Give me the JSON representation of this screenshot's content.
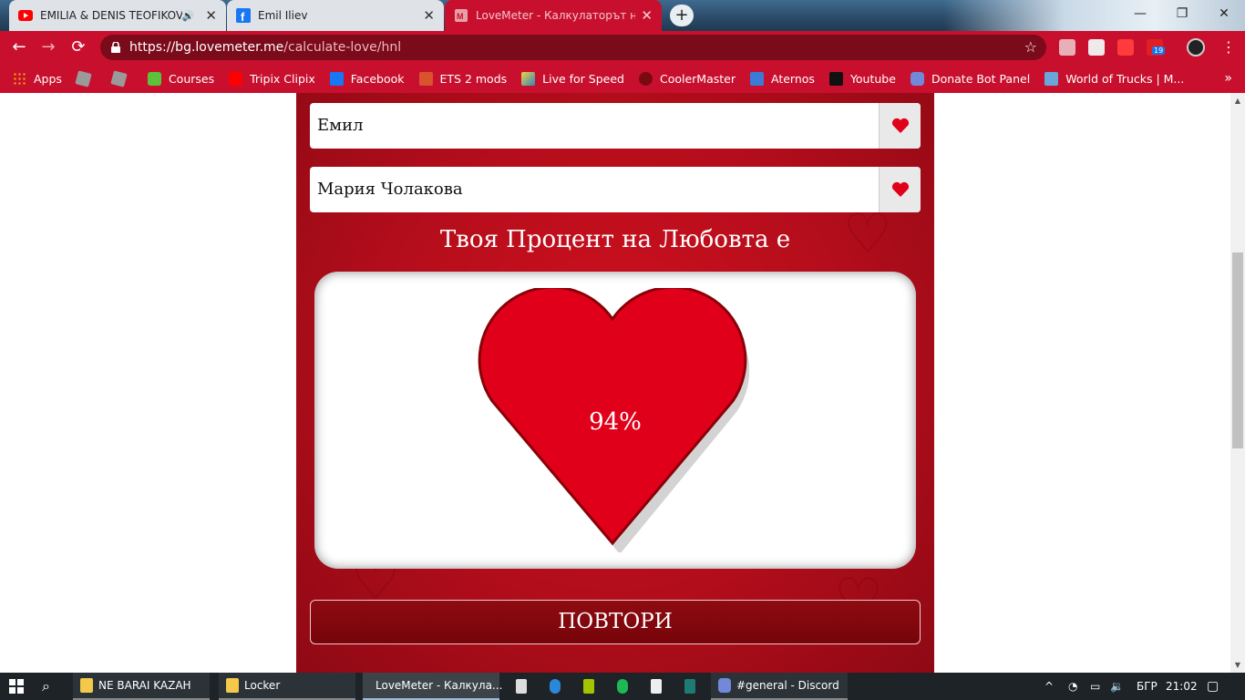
{
  "tabs": [
    {
      "title": "EMILIA & DENIS TEOFIKOV - ",
      "favicon": "youtube-icon",
      "audio": true
    },
    {
      "title": "Emil Iliev",
      "favicon": "facebook-icon",
      "audio": false
    },
    {
      "title": "LoveMeter - Калкулаторът на Ис",
      "favicon": "lovemeter-icon",
      "audio": false,
      "active": true
    }
  ],
  "new_tab_symbol": "+",
  "window_controls": {
    "minimize": "—",
    "maximize": "❐",
    "close": "✕"
  },
  "nav": {
    "back": "←",
    "forward": "→",
    "reload": "⟳"
  },
  "address": {
    "host": "https://bg.lovemeter.me",
    "path": "/calculate-love/hnl"
  },
  "bookmarks": [
    {
      "label": "Apps",
      "icon": "apps-grid-icon"
    },
    {
      "label": "",
      "icon": "roblox-icon"
    },
    {
      "label": "",
      "icon": "roblox-icon"
    },
    {
      "label": "Courses",
      "icon": "courses-icon"
    },
    {
      "label": "Tripix Clipix",
      "icon": "youtube-icon"
    },
    {
      "label": "Facebook",
      "icon": "facebook-icon"
    },
    {
      "label": "ETS 2 mods",
      "icon": "ets-icon"
    },
    {
      "label": "Live for Speed",
      "icon": "lfs-icon"
    },
    {
      "label": "CoolerMaster",
      "icon": "coolermaster-icon"
    },
    {
      "label": "Aternos",
      "icon": "aternos-icon"
    },
    {
      "label": "Youtube",
      "icon": "youtube-dark-icon"
    },
    {
      "label": "Donate Bot Panel",
      "icon": "discord-icon"
    },
    {
      "label": "World of Trucks | M...",
      "icon": "worldoftrucks-icon"
    }
  ],
  "bookmarks_more": "»",
  "extensions_badge": "19",
  "page": {
    "name1": "Емил",
    "name2": "Мария Чолакова",
    "result_heading": "Твоя Процент на Любовта е",
    "percent_text": "94%",
    "love_percent": 94,
    "repeat_button": "ПОВТОРИ"
  },
  "taskbar": {
    "windows": [
      {
        "label": "NE BARAI KAZAH",
        "icon": "folder-icon"
      },
      {
        "label": "Locker",
        "icon": "folder-icon"
      },
      {
        "label": "LoveMeter - Калкула...",
        "icon": "chrome-icon",
        "active": true
      },
      {
        "label": "#general - Discord",
        "icon": "discord-icon"
      }
    ],
    "language": "БГР",
    "time": "21:02"
  },
  "colors": {
    "brand_red": "#c8102e",
    "panel_red": "#b20d1b",
    "heart_red": "#e0001a",
    "button_dark": "#7a060c"
  }
}
